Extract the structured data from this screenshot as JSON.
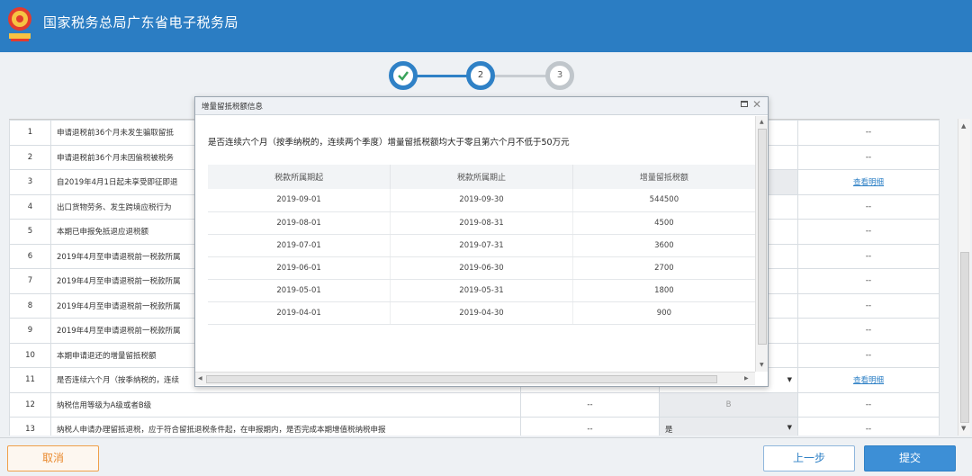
{
  "header": {
    "title": "国家税务总局广东省电子税务局",
    "brand_color": "#2b7dc3",
    "emblem_icon": "tax-emblem-icon"
  },
  "steps": [
    {
      "label": "",
      "state": "done",
      "icon": "check-icon"
    },
    {
      "label": "2",
      "state": "active"
    },
    {
      "label": "3",
      "state": "todo"
    }
  ],
  "table": {
    "rows": [
      {
        "no": "1",
        "desc": "申请退税前36个月未发生骗取留抵",
        "c1": "",
        "c2": "",
        "c3": "--"
      },
      {
        "no": "2",
        "desc": "申请退税前36个月未因偷税被税务",
        "c1": "",
        "c2": "",
        "c3": "--"
      },
      {
        "no": "3",
        "desc": "自2019年4月1日起未享受即征即退",
        "c1": "",
        "c2": "",
        "c3": "查看明细"
      },
      {
        "no": "4",
        "desc": "出口货物劳务、发生跨境应税行为",
        "c1": "",
        "c2": "",
        "c3": "--"
      },
      {
        "no": "5",
        "desc": "本期已申报免抵退应退税额",
        "c1": "",
        "c2": "",
        "c3": "--"
      },
      {
        "no": "6",
        "desc": "2019年4月至申请退税前一税款所属",
        "c1": "",
        "c2": "",
        "c3": "--"
      },
      {
        "no": "7",
        "desc": "2019年4月至申请退税前一税款所属",
        "c1": "",
        "c2": "",
        "c3": "--"
      },
      {
        "no": "8",
        "desc": "2019年4月至申请退税前一税款所属",
        "c1": "",
        "c2": "",
        "c3": "--"
      },
      {
        "no": "9",
        "desc": "2019年4月至申请退税前一税款所属",
        "c1": "",
        "c2": "",
        "c3": "--"
      },
      {
        "no": "10",
        "desc": "本期申请退还的增量留抵税额",
        "c1": "",
        "c2": "",
        "c3": "--"
      },
      {
        "no": "11",
        "desc": "是否连续六个月（按季纳税的，连续",
        "c1": "",
        "c2": "",
        "c3": "查看明细"
      },
      {
        "no": "12",
        "desc": "纳税信用等级为A级或者B级",
        "c1": "--",
        "c2": "B",
        "c3": "--"
      },
      {
        "no": "13",
        "desc": "纳税人申请办理留抵退税，应于符合留抵退税条件起，在申报期内，是否完成本期增值税纳税申报",
        "c1": "--",
        "c2": "是",
        "c3": "--"
      }
    ]
  },
  "modal": {
    "title": "增量留抵税额信息",
    "question": "是否连续六个月（按季纳税的，连续两个季度）增量留抵税额均大于零且第六个月不低于50万元",
    "columns": [
      "税款所属期起",
      "税款所属期止",
      "增量留抵税额"
    ],
    "rows": [
      [
        "2019-09-01",
        "2019-09-30",
        "544500"
      ],
      [
        "2019-08-01",
        "2019-08-31",
        "4500"
      ],
      [
        "2019-07-01",
        "2019-07-31",
        "3600"
      ],
      [
        "2019-06-01",
        "2019-06-30",
        "2700"
      ],
      [
        "2019-05-01",
        "2019-05-31",
        "1800"
      ],
      [
        "2019-04-01",
        "2019-04-30",
        "900"
      ]
    ]
  },
  "buttons": {
    "cancel": "取消",
    "prev": "上一步",
    "submit": "提交"
  }
}
